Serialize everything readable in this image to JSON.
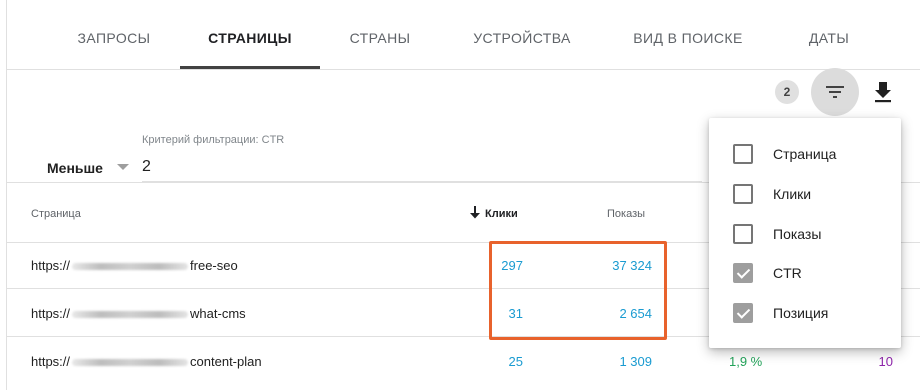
{
  "tabs": [
    {
      "label": "ЗАПРОСЫ",
      "active": false
    },
    {
      "label": "СТРАНИЦЫ",
      "active": true
    },
    {
      "label": "СТРАНЫ",
      "active": false
    },
    {
      "label": "УСТРОЙСТВА",
      "active": false
    },
    {
      "label": "ВИД В ПОИСКЕ",
      "active": false
    },
    {
      "label": "ДАТЫ",
      "active": false
    }
  ],
  "toolbar": {
    "filter_count": "2",
    "filter_icon": "filter-list-icon",
    "download_icon": "download-icon"
  },
  "filter": {
    "criterion_label": "Критерий фильтрации: CTR",
    "operator": "Меньше",
    "value": "2"
  },
  "table": {
    "columns": {
      "page": "Страница",
      "clicks": "Клики",
      "impressions": "Показы"
    },
    "sort_icon": "arrow-down-icon",
    "rows": [
      {
        "url_start": "https://",
        "url_end": "free-seo",
        "clicks": "297",
        "impressions": "37 324",
        "ctr": "",
        "position": ""
      },
      {
        "url_start": "https://",
        "url_end": "what-cms",
        "clicks": "31",
        "impressions": "2 654",
        "ctr": "",
        "position": ""
      },
      {
        "url_start": "https://",
        "url_end": "content-plan",
        "clicks": "25",
        "impressions": "1 309",
        "ctr": "1,9 %",
        "position": "10"
      }
    ]
  },
  "column_menu": {
    "items": [
      {
        "label": "Страница",
        "checked": false
      },
      {
        "label": "Клики",
        "checked": false
      },
      {
        "label": "Показы",
        "checked": false
      },
      {
        "label": "CTR",
        "checked": true
      },
      {
        "label": "Позиция",
        "checked": true
      }
    ]
  },
  "colors": {
    "highlight": "#e8622c",
    "clicks": "#1a9bd1",
    "ctr": "#23a35a",
    "position": "#8e24aa"
  }
}
